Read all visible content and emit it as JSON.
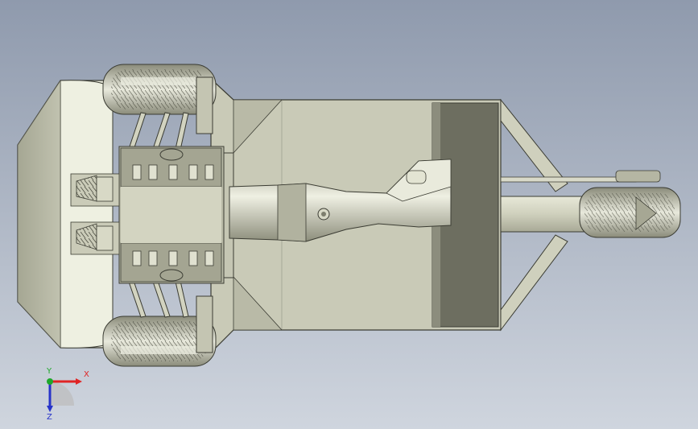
{
  "viewport": {
    "background_top": "#8f9aad",
    "background_bottom": "#cfd5de"
  },
  "model": {
    "body_color": "#cfd0bd",
    "shade_color": "#7f806f",
    "dark_panel_color": "#6d6e60",
    "edge_color": "#3b3c33",
    "tire_color": "#d8d9cc"
  },
  "triad": {
    "x_label": "X",
    "y_label": "Y",
    "z_label": "Z",
    "x_color": "#e02424",
    "y_color": "#1fa82b",
    "z_color": "#2733c9"
  }
}
